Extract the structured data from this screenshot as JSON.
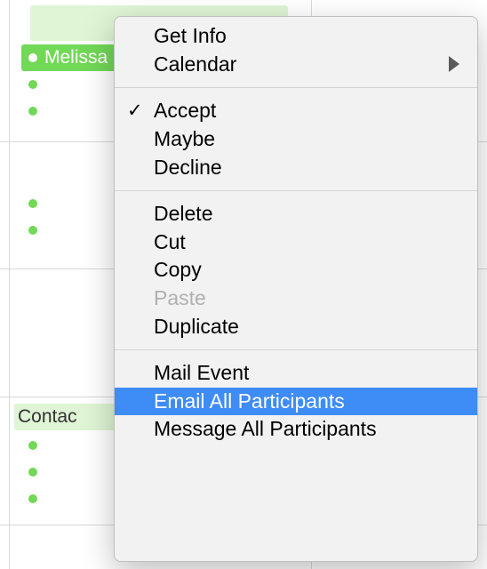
{
  "calendar": {
    "selected_event_label": "Melissa",
    "event_bottom_label": "Contac"
  },
  "menu": {
    "get_info": "Get Info",
    "calendar": "Calendar",
    "accept": "Accept",
    "maybe": "Maybe",
    "decline": "Decline",
    "delete": "Delete",
    "cut": "Cut",
    "copy": "Copy",
    "paste": "Paste",
    "duplicate": "Duplicate",
    "mail_event": "Mail Event",
    "email_all": "Email All Participants",
    "message_all": "Message All Participants",
    "accepted_state": true,
    "highlighted_item": "email_all"
  }
}
